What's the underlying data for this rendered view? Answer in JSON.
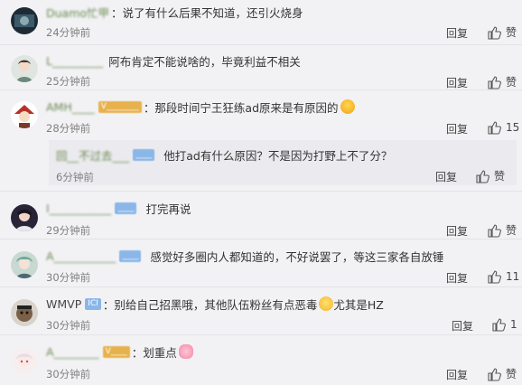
{
  "comments": [
    {
      "id": 1,
      "username": "Duamo忙甲",
      "text": "：说了有什么后果不知道，还引火烧身",
      "time": "24分钟前",
      "reply_label": "回复",
      "like_label": "赞"
    },
    {
      "id": 2,
      "username": "L_________",
      "text": "阿布肯定不能说啥的，毕竟利益不相关",
      "time": "25分钟前",
      "reply_label": "回复",
      "like_label": "赞"
    },
    {
      "id": 3,
      "username": "AMH____",
      "badge": "V________",
      "text": "：那段时间宁王狂练ad原来是有原因的",
      "time": "28分钟前",
      "reply_label": "回复",
      "like_label": "15",
      "nested": {
        "username": "回__不过去___",
        "badge": "____",
        "text": "他打ad有什么原因？不是因为打野上不了分？",
        "time": "6分钟前",
        "reply_label": "回复",
        "like_label": "赞"
      }
    },
    {
      "id": 4,
      "username": "I___________",
      "badge": "____",
      "text": "打完再说",
      "time": "29分钟前",
      "reply_label": "回复",
      "like_label": "赞"
    },
    {
      "id": 5,
      "username": "A___________",
      "badge": "____",
      "text": "感觉好多圈内人都知道的，不好说罢了，等这三家各自放锤",
      "time": "30分钟前",
      "reply_label": "回复",
      "like_label": "11"
    },
    {
      "id": 6,
      "username": "WMVP",
      "badge": "ICI",
      "text": "：别给自己招黑哦，其他队伍粉丝有点恶毒",
      "text_after": "尤其是HZ",
      "time": "30分钟前",
      "reply_label": "回复",
      "like_label": "1"
    },
    {
      "id": 7,
      "username": "A________",
      "badge": "V____",
      "text": "：划重点",
      "time": "30分钟前",
      "reply_label": "回复",
      "like_label": "赞"
    }
  ]
}
